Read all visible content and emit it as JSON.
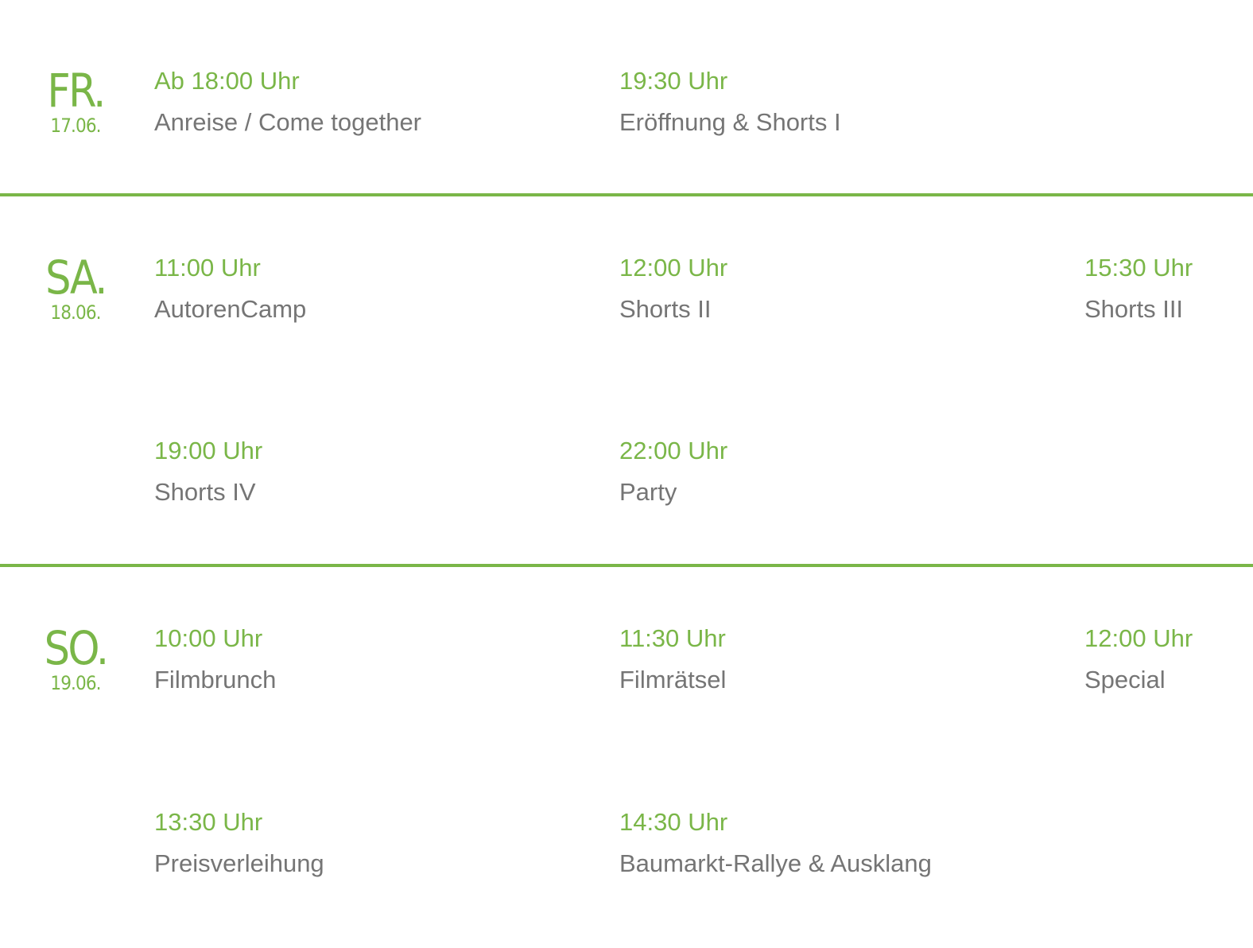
{
  "colors": {
    "accent": "#7ab648",
    "text": "#757575",
    "background": "#ffffff"
  },
  "days": [
    {
      "name": "FR.",
      "date": "17.06.",
      "events": [
        {
          "time": "Ab 18:00 Uhr",
          "title": "Anreise / Come together"
        },
        {
          "time": "19:30 Uhr",
          "title": "Eröffnung & Shorts I"
        }
      ]
    },
    {
      "name": "SA.",
      "date": "18.06.",
      "events": [
        {
          "time": "11:00 Uhr",
          "title": "AutorenCamp"
        },
        {
          "time": "12:00 Uhr",
          "title": "Shorts II"
        },
        {
          "time": "15:30 Uhr",
          "title": "Shorts III"
        },
        {
          "time": "19:00 Uhr",
          "title": "Shorts IV"
        },
        {
          "time": "22:00 Uhr",
          "title": "Party"
        }
      ]
    },
    {
      "name": "SO.",
      "date": "19.06.",
      "events": [
        {
          "time": "10:00 Uhr",
          "title": "Filmbrunch"
        },
        {
          "time": "11:30 Uhr",
          "title": "Filmrätsel"
        },
        {
          "time": "12:00 Uhr",
          "title": "Special"
        },
        {
          "time": "13:30 Uhr",
          "title": "Preisverleihung"
        },
        {
          "time": "14:30 Uhr",
          "title": "Baumarkt-Rallye & Ausklang"
        }
      ]
    }
  ]
}
